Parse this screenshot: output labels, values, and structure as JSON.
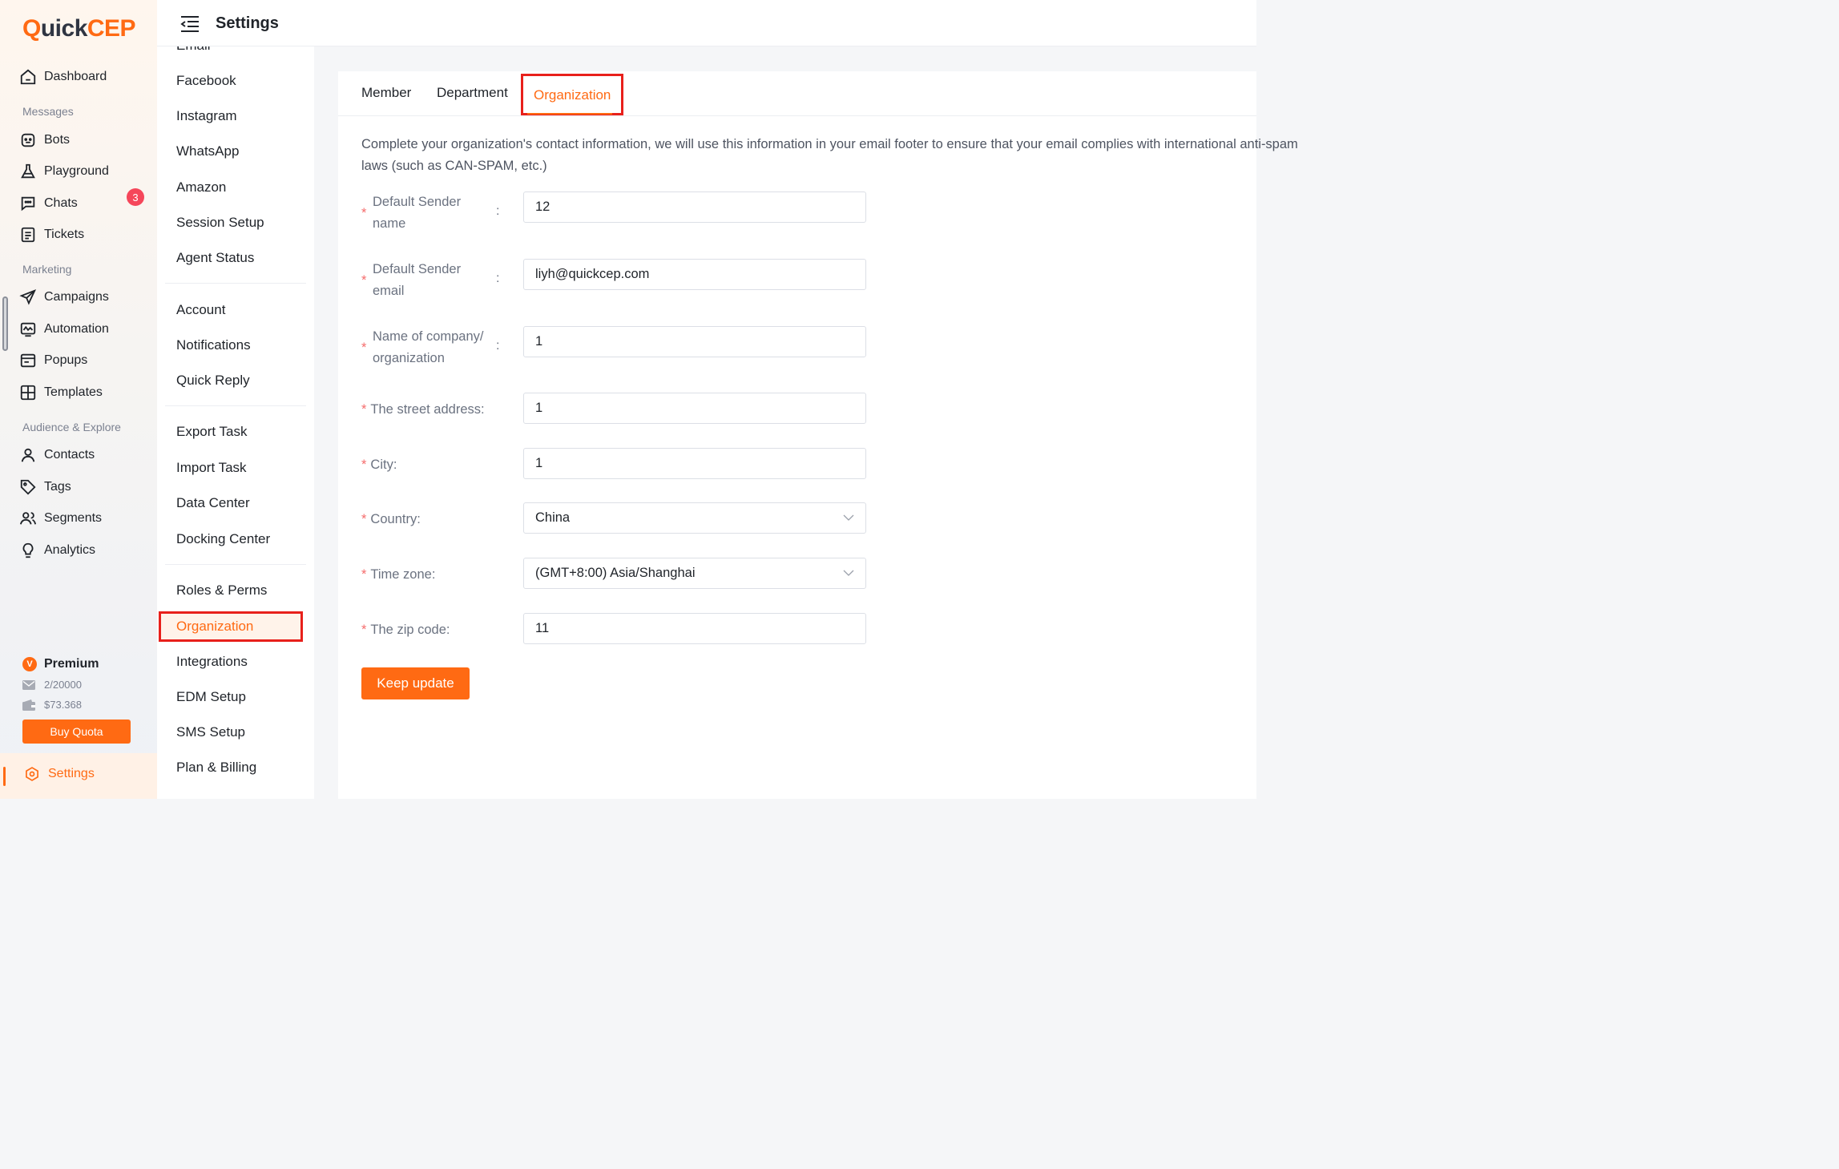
{
  "brand": {
    "logo_q": "Q",
    "logo_uick": "uick",
    "logo_cep": "CEP"
  },
  "leftnav": {
    "dashboard": "Dashboard",
    "messages_section": "Messages",
    "bots": "Bots",
    "playground": "Playground",
    "chats": "Chats",
    "chats_badge": "3",
    "tickets": "Tickets",
    "marketing_section": "Marketing",
    "campaigns": "Campaigns",
    "automation": "Automation",
    "popups": "Popups",
    "templates": "Templates",
    "audience_section": "Audience & Explore",
    "contacts": "Contacts",
    "tags": "Tags",
    "segments": "Segments",
    "analytics": "Analytics",
    "plan_name": "Premium",
    "plan_badge": "V",
    "email_quota": "2/20000",
    "balance": "$73.368",
    "buy_quota": "Buy Quota",
    "settings": "Settings"
  },
  "header": {
    "title": "Settings"
  },
  "submenu": {
    "cut_item": "Email",
    "items": [
      "Facebook",
      "Instagram",
      "WhatsApp",
      "Amazon",
      "Session Setup",
      "Agent Status",
      "Account",
      "Notifications",
      "Quick Reply",
      "Export Task",
      "Import Task",
      "Data Center",
      "Docking Center",
      "Roles & Perms",
      "Organization",
      "Integrations",
      "EDM Setup",
      "SMS Setup",
      "Plan & Billing"
    ]
  },
  "tabs": {
    "member": "Member",
    "department": "Department",
    "organization": "Organization"
  },
  "description": "Complete your organization's contact information, we will use this information in your email footer to ensure that your email complies with international anti-spam laws (such as CAN-SPAM, etc.)",
  "form": {
    "sender_name_label_1": "Default Sender",
    "sender_name_label_2": "name",
    "sender_name_value": "12",
    "sender_email_label_1": "Default Sender",
    "sender_email_label_2": "email",
    "sender_email_value": "liyh@quickcep.com",
    "company_label_1": "Name of company/",
    "company_label_2": "organization",
    "company_value": "1",
    "street_label": "The street address:",
    "street_value": "1",
    "city_label": "City:",
    "city_value": "1",
    "country_label": "Country:",
    "country_value": "China",
    "timezone_label": "Time zone:",
    "timezone_value": "(GMT+8:00) Asia/Shanghai",
    "zip_label": "The zip code:",
    "zip_value": "11",
    "colon": ":",
    "required_mark": "*",
    "submit": "Keep update"
  },
  "colors": {
    "accent": "#ff6a13",
    "highlight_box": "#e8201b",
    "badge": "#f5465a"
  }
}
